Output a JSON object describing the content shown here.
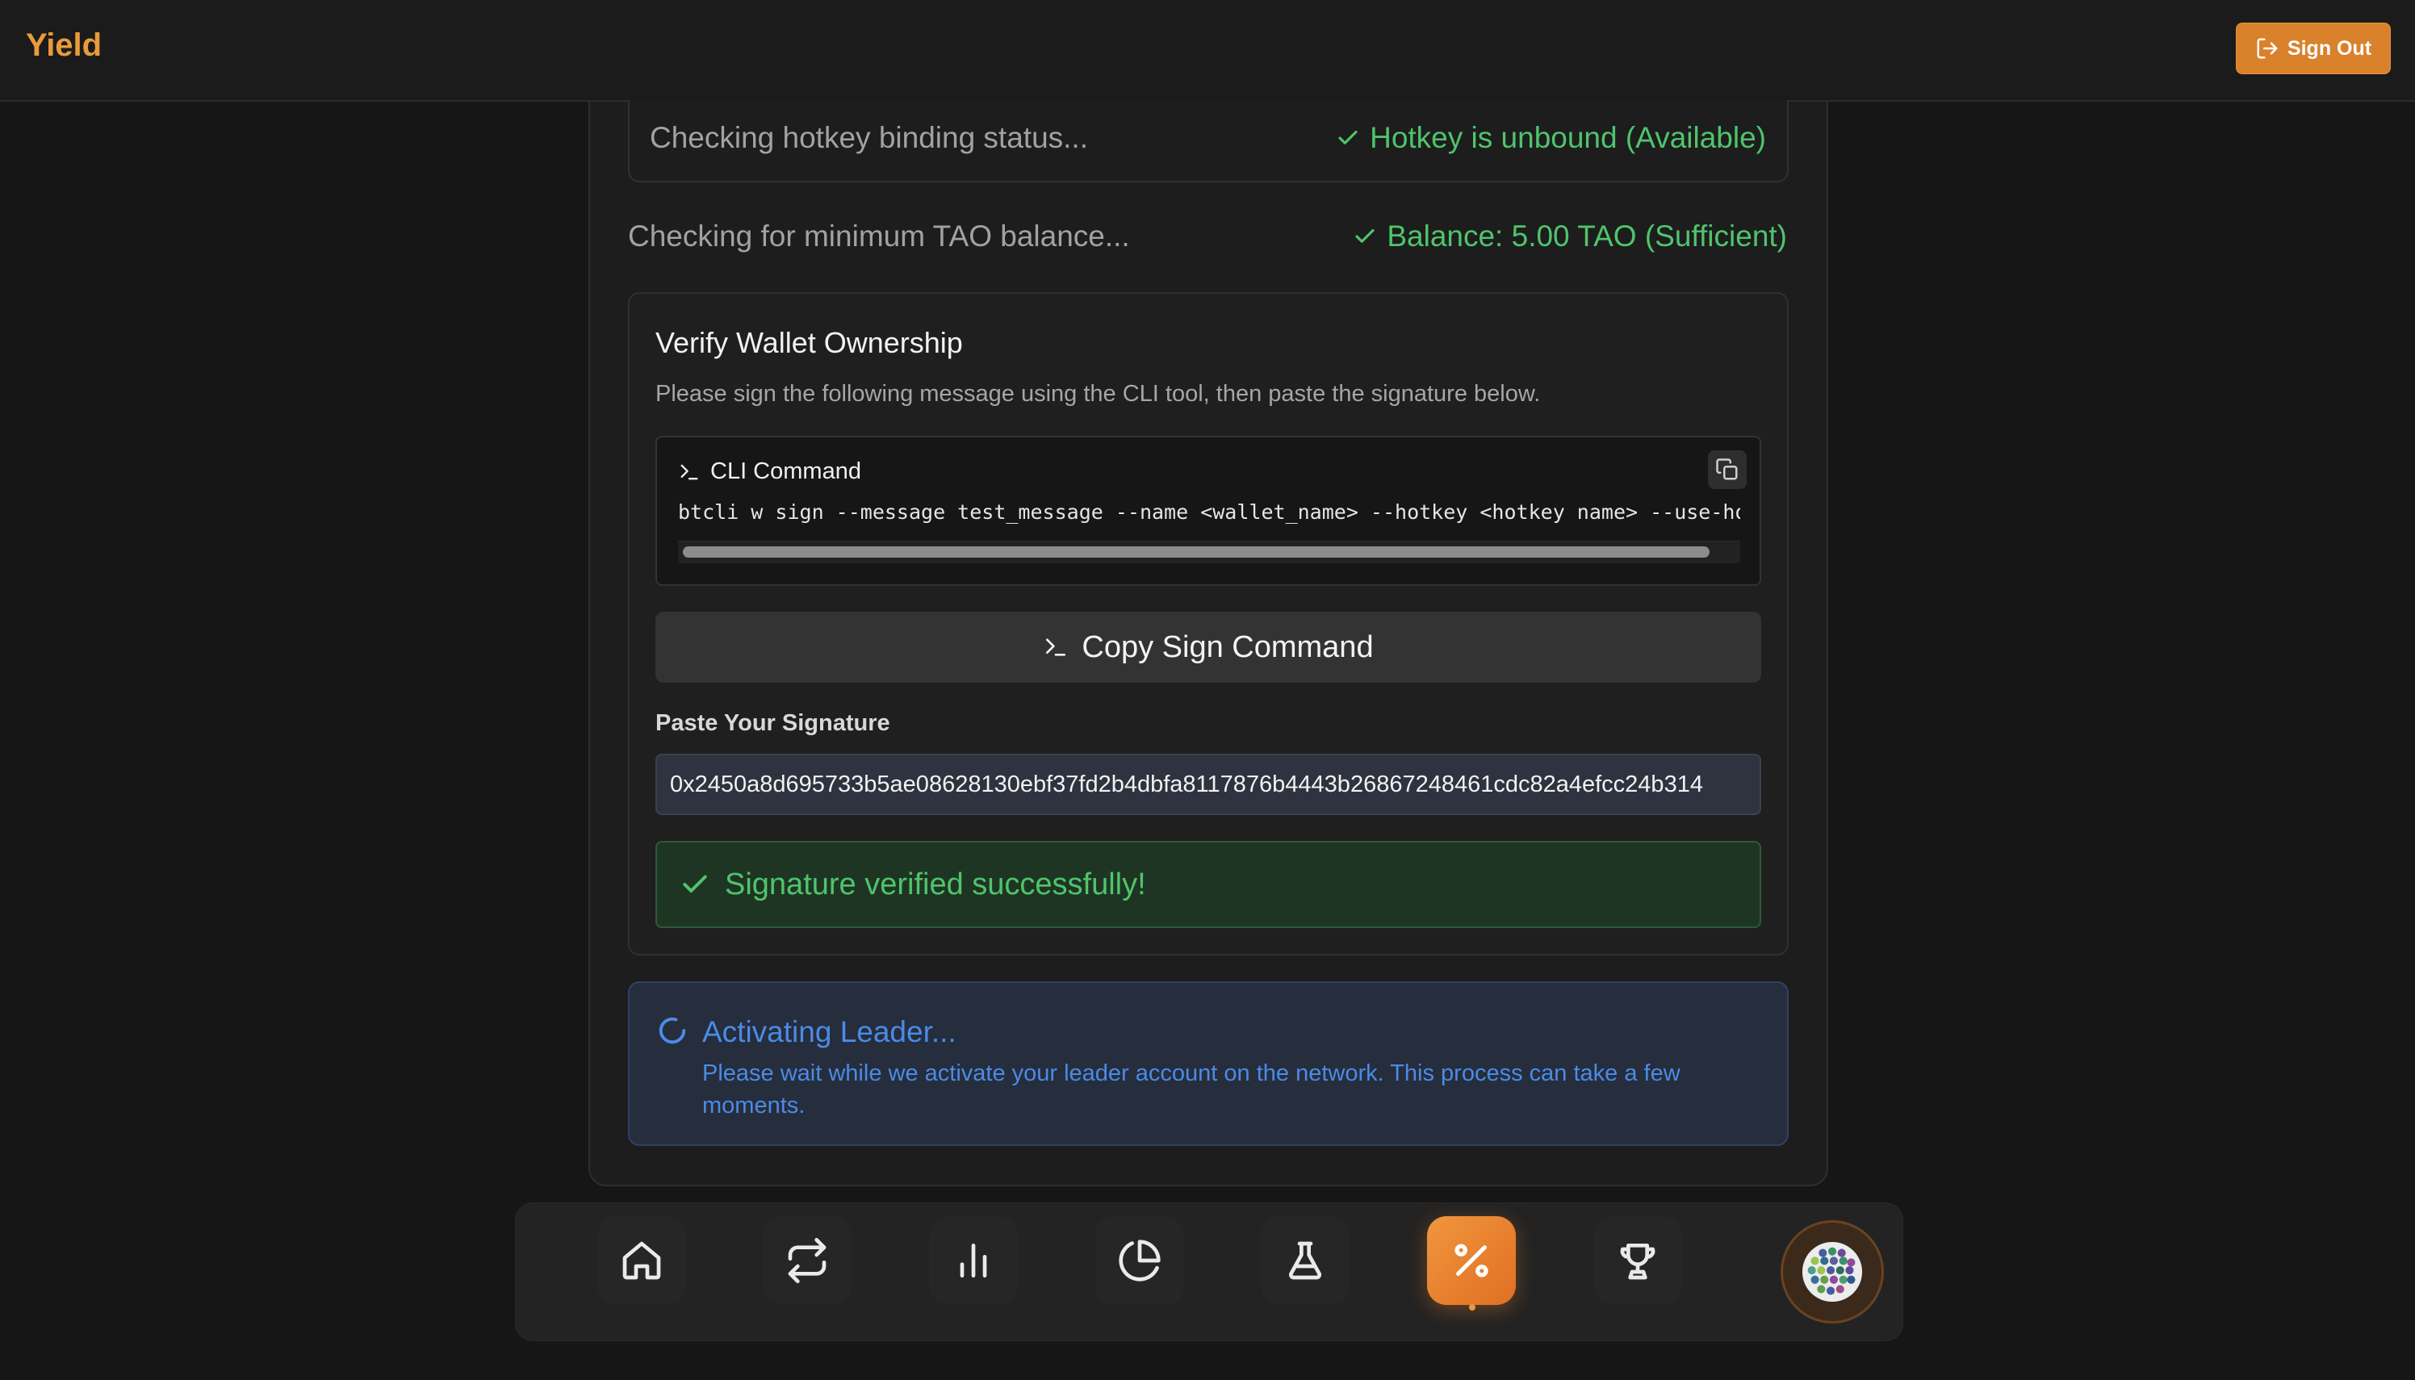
{
  "header": {
    "logo": "Yield",
    "sign_out_label": "Sign Out"
  },
  "checks": {
    "hotkey_label": "Checking hotkey binding status...",
    "hotkey_status": "Hotkey is unbound (Available)",
    "balance_label": "Checking for minimum TAO balance...",
    "balance_status": "Balance: 5.00 TAO (Sufficient)"
  },
  "verify": {
    "title": "Verify Wallet Ownership",
    "description": "Please sign the following message using the CLI tool, then paste the signature below.",
    "cli_title": "CLI Command",
    "cli_command": "btcli w sign --message test_message --name <wallet_name> --hotkey <hotkey name>  --use-hotk",
    "copy_button": "Copy Sign Command",
    "signature_label": "Paste Your Signature",
    "signature_value": "0x2450a8d695733b5ae08628130ebf37fd2b4dbfa8117876b4443b26867248461cdc82a4efcc24b314",
    "success_message": "Signature verified successfully!"
  },
  "activating": {
    "title": "Activating Leader...",
    "description": "Please wait while we activate your leader account on the network. This process can take a few moments."
  },
  "nav": {
    "items": [
      "home-icon",
      "swap-icon",
      "bar-chart-icon",
      "pie-chart-icon",
      "flask-icon",
      "percent-icon",
      "trophy-icon"
    ],
    "active": "percent-icon"
  },
  "colors": {
    "accent": "#e89a3c",
    "success": "#4fc46c",
    "info": "#4a8be6",
    "background": "#161616"
  }
}
